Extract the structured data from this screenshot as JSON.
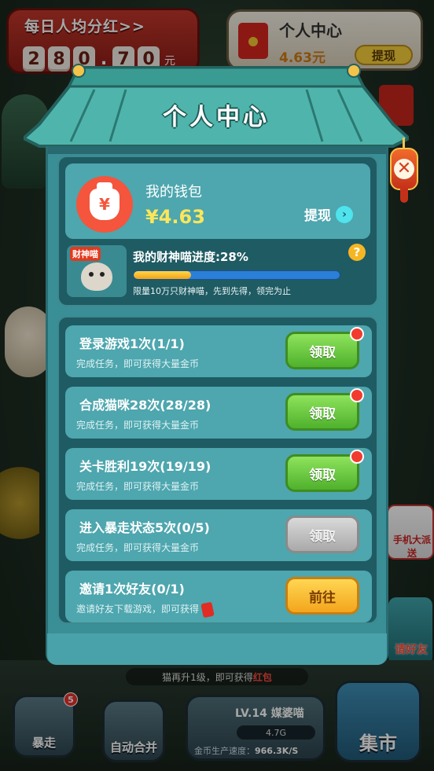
{
  "background": {
    "daily_banner": {
      "title": "每日人均分红>>",
      "digits": [
        "2",
        "8",
        "0",
        ".",
        "7",
        "0"
      ],
      "unit": "元"
    },
    "center_banner": {
      "title": "个人中心",
      "amount": "4.63元",
      "button": "提现"
    },
    "phone_promo": "手机大派送",
    "invite_promo": "请好友",
    "hint": {
      "prefix": "猫再升1级，即可获得",
      "highlight": "红包"
    },
    "bottom": {
      "rush_label": "暴走",
      "rush_badge": "5",
      "merge_label": "自动合并",
      "market_label": "集市",
      "cat_level": "LV.14 媒婆喵",
      "coins": "4.7G",
      "speed_label": "金币生产速度：",
      "speed_value": "966.3K/S"
    }
  },
  "modal": {
    "title": "个人中心",
    "wallet": {
      "label": "我的钱包",
      "amount": "¥4.63",
      "withdraw": "提现",
      "bag_symbol": "¥"
    },
    "progress": {
      "avatar_tag": "财神喵",
      "title": "我的财神喵进度:28%",
      "percent": 28,
      "note": "限量10万只财神喵，先到先得，领完为止"
    },
    "tasks": [
      {
        "title": "登录游戏1次(1/1)",
        "subtitle": "完成任务，即可获得大量金币",
        "button": "领取",
        "state": "green",
        "dot": true
      },
      {
        "title": "合成猫咪28次(28/28)",
        "subtitle": "完成任务，即可获得大量金币",
        "button": "领取",
        "state": "green",
        "dot": true
      },
      {
        "title": "关卡胜利19次(19/19)",
        "subtitle": "完成任务，即可获得大量金币",
        "button": "领取",
        "state": "green",
        "dot": true
      },
      {
        "title": "进入暴走状态5次(0/5)",
        "subtitle": "完成任务，即可获得大量金币",
        "button": "领取",
        "state": "gray",
        "dot": false
      },
      {
        "title": "邀请1次好友(0/1)",
        "subtitle": "邀请好友下载游戏，即可获得",
        "button": "前往",
        "state": "orange",
        "dot": false
      }
    ]
  },
  "colors": {
    "teal": "#3a8e95",
    "panel_dark": "#1f5b63",
    "panel_light": "#4ea6ae",
    "gold": "#fbe65b",
    "red_dot": "#f13b2f"
  }
}
